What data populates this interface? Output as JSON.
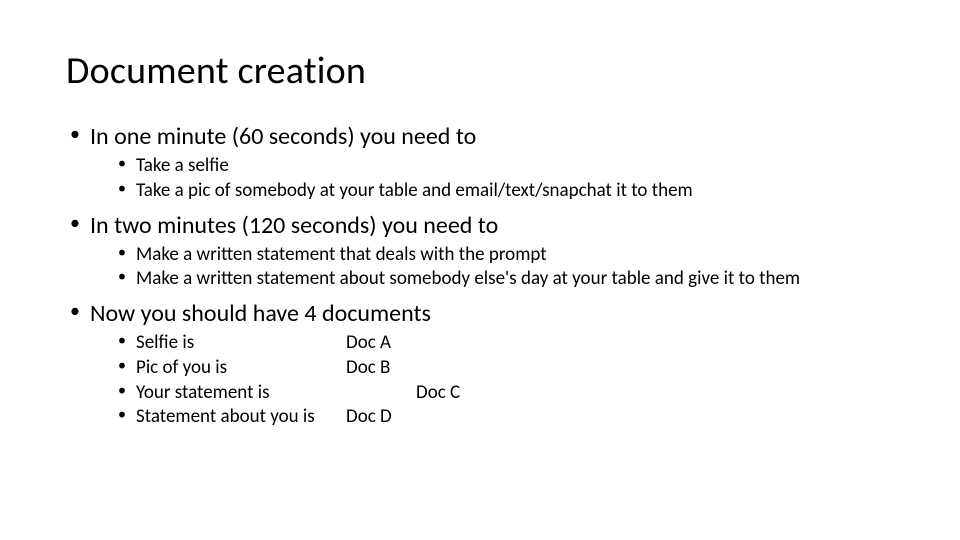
{
  "title": "Document creation",
  "bullets": {
    "b1": "In one minute (60 seconds) you need to",
    "b1_subs": {
      "s1": "Take a selfie",
      "s2": "Take a pic of somebody at your table and email/text/snapchat it to them"
    },
    "b2": "In two minutes (120 seconds) you need to",
    "b2_subs": {
      "s1": "Make a written statement that deals with the prompt",
      "s2": "Make a written statement about somebody else's day at your table and give it to them"
    },
    "b3": "Now you should have 4 documents",
    "b3_subs": {
      "r1_left": "Selfie is",
      "r1_right": "Doc A",
      "r2_left": "Pic of you is",
      "r2_right": "Doc B",
      "r3_left": "Your statement is",
      "r3_right": "Doc C",
      "r4_left": "Statement about you is",
      "r4_right": "Doc D"
    }
  }
}
